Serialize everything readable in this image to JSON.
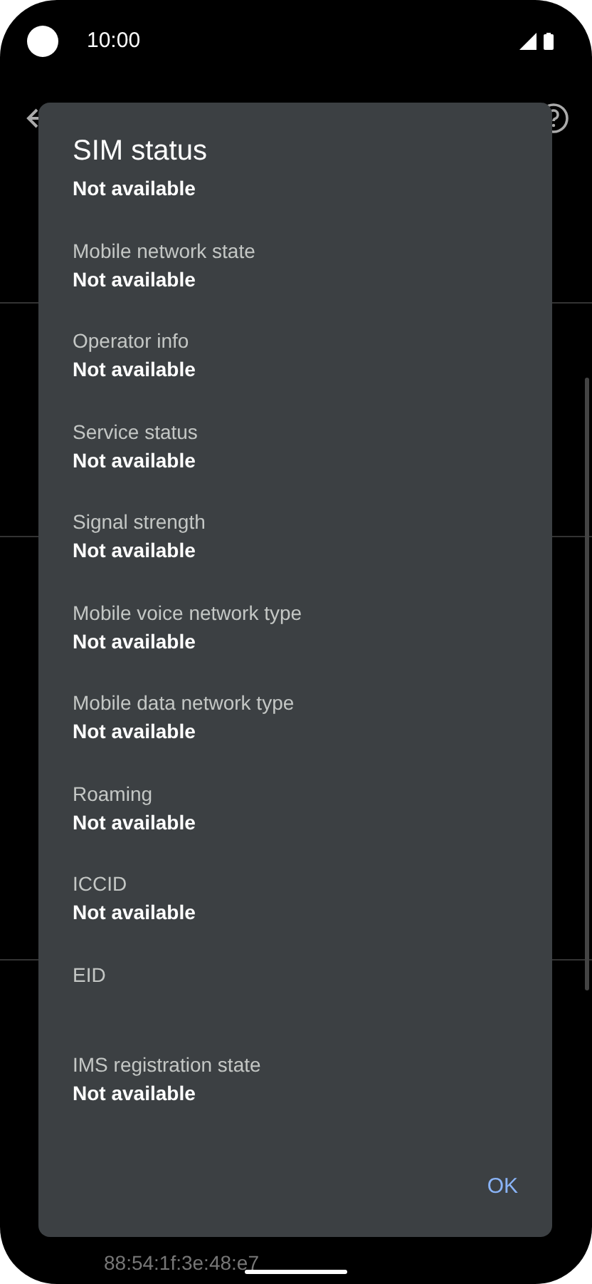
{
  "status_bar": {
    "time": "10:00"
  },
  "dialog": {
    "title": "SIM status",
    "subtitle": "Not available",
    "fields": [
      {
        "label": "Mobile network state",
        "value": "Not available"
      },
      {
        "label": "Operator info",
        "value": "Not available"
      },
      {
        "label": "Service status",
        "value": "Not available"
      },
      {
        "label": "Signal strength",
        "value": "Not available"
      },
      {
        "label": "Mobile voice network type",
        "value": "Not available"
      },
      {
        "label": "Mobile data network type",
        "value": "Not available"
      },
      {
        "label": "Roaming",
        "value": "Not available"
      },
      {
        "label": "ICCID",
        "value": "Not available"
      },
      {
        "label": "EID"
      },
      {
        "label": "IMS registration state",
        "value": "Not available"
      }
    ],
    "button": "OK"
  },
  "background": {
    "mac_value": "88:54:1f:3e:48:e7"
  }
}
